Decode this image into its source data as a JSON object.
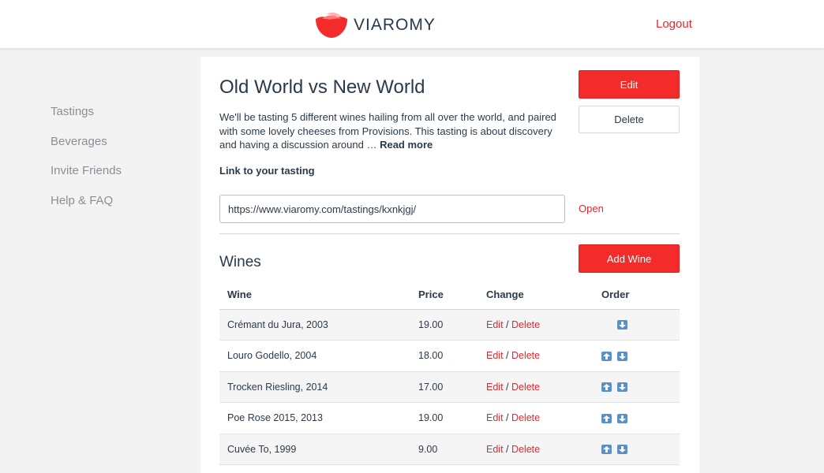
{
  "header": {
    "brand": "VIAROMY",
    "logout_label": "Logout",
    "brand_color": "#f42b2b"
  },
  "sidebar": {
    "items": [
      {
        "label": "Tastings"
      },
      {
        "label": "Beverages"
      },
      {
        "label": "Invite Friends"
      },
      {
        "label": "Help & FAQ"
      }
    ]
  },
  "tasting": {
    "title": "Old World vs New World",
    "description": "We'll be tasting 5 different wines hailing from all over the world, and paired with some lovely cheeses from Provisions. This tasting is about discovery and having a discussion around … ",
    "read_more": "Read more",
    "edit_label": "Edit",
    "delete_label": "Delete"
  },
  "link": {
    "label": "Link to your tasting",
    "url": "https://www.viaromy.com/tastings/kxnkjgj/",
    "open_label": "Open"
  },
  "wines": {
    "title": "Wines",
    "add_label": "Add Wine",
    "columns": {
      "wine": "Wine",
      "price": "Price",
      "change": "Change",
      "order": "Order"
    },
    "edit_label": "Edit",
    "delete_label": "Delete",
    "separator": " / ",
    "rows": [
      {
        "wine": "Crémant du Jura, 2003",
        "price": "19.00",
        "up": false,
        "down": true
      },
      {
        "wine": "Louro Godello, 2004",
        "price": "18.00",
        "up": true,
        "down": true
      },
      {
        "wine": "Trocken Riesling, 2014",
        "price": "17.00",
        "up": true,
        "down": true
      },
      {
        "wine": "Poe Rose 2015, 2013",
        "price": "19.00",
        "up": true,
        "down": true
      },
      {
        "wine": "Cuvée To, 1999",
        "price": "9.00",
        "up": true,
        "down": true
      }
    ]
  }
}
